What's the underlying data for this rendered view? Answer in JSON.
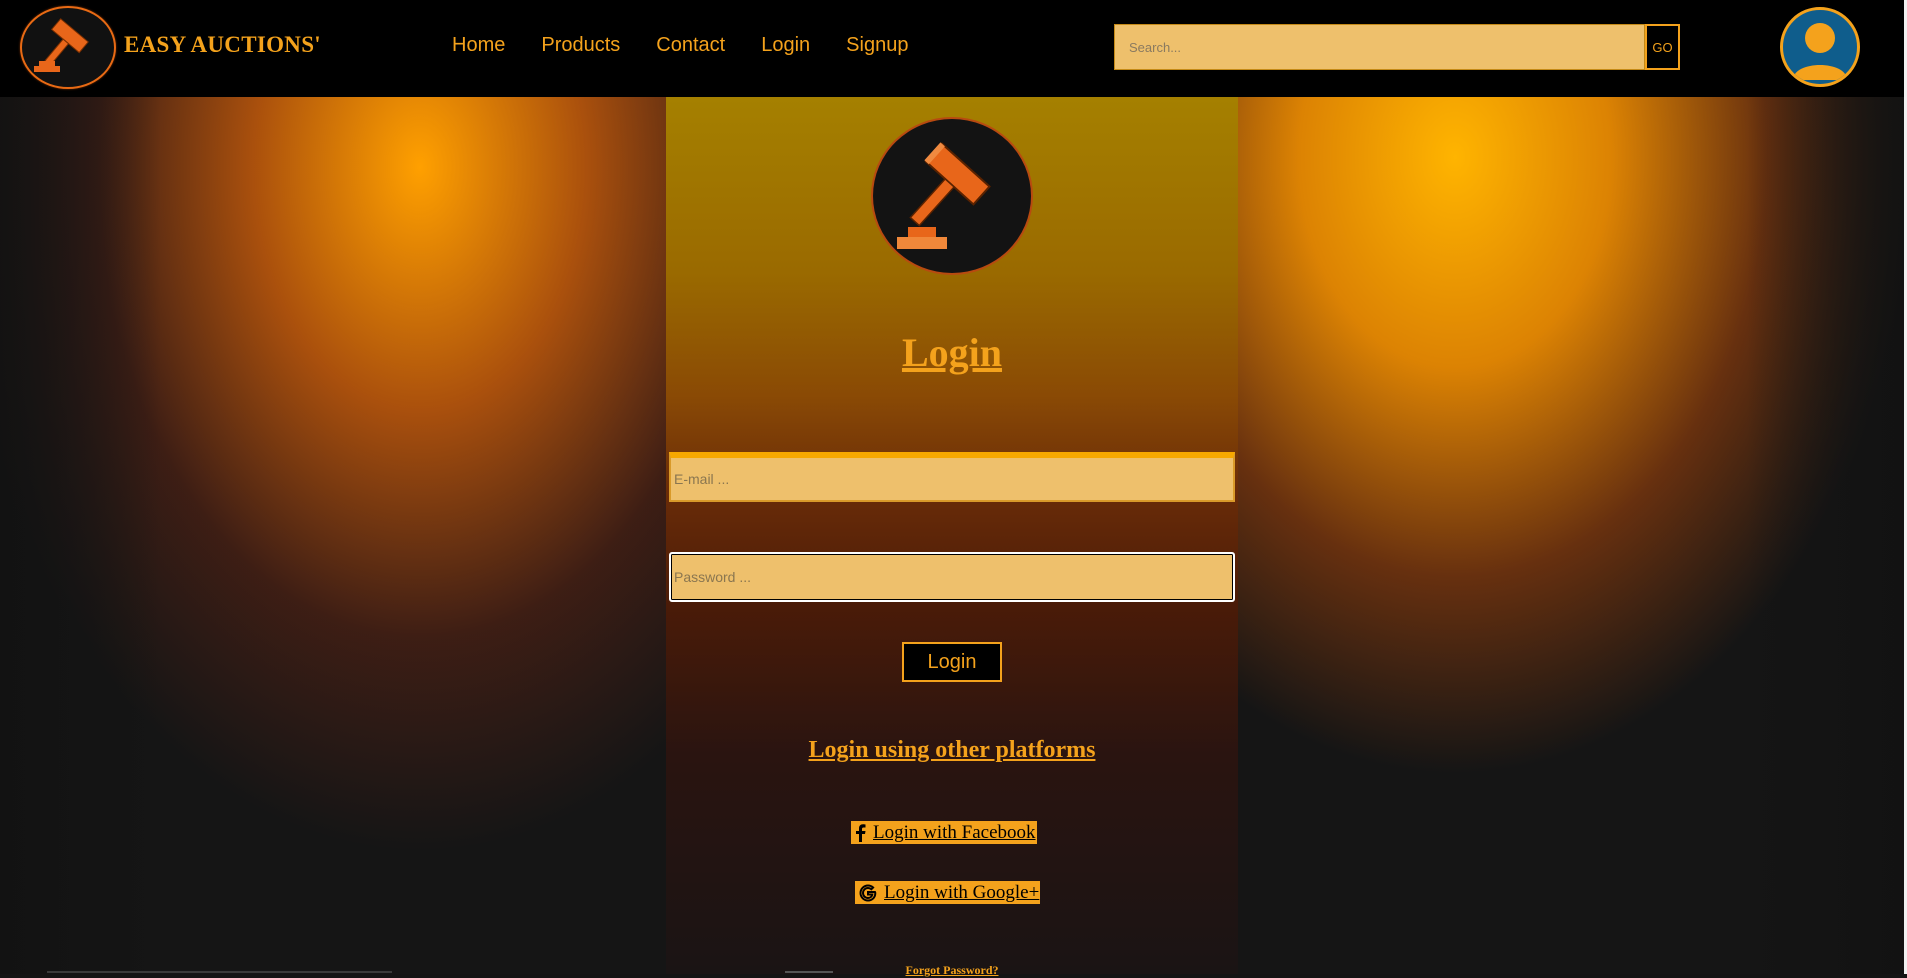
{
  "header": {
    "brand_name": "EASY AUCTIONS'",
    "brand_logo_icon": "gavel-icon",
    "nav_items": [
      {
        "label": "Home"
      },
      {
        "label": "Products"
      },
      {
        "label": "Contact"
      },
      {
        "label": "Login"
      },
      {
        "label": "Signup"
      }
    ],
    "search": {
      "placeholder": "Search...",
      "value": "",
      "button_label": "GO"
    },
    "avatar_icon": "user-icon"
  },
  "login_panel": {
    "logo_icon": "gavel-icon",
    "title": "Login",
    "email": {
      "placeholder": "E-mail ...",
      "value": ""
    },
    "password": {
      "placeholder": "Password ...",
      "value": ""
    },
    "login_button_label": "Login",
    "other_platforms_title": "Login using other platforms",
    "facebook_label": " Login with Facebook",
    "facebook_icon": "facebook-icon",
    "google_label": " Login with Google+",
    "google_icon": "google-icon",
    "forgot_password_label": "Forgot Password?"
  },
  "colors": {
    "accent": "#f4a21c",
    "input_bg": "#eec06c",
    "header_bg": "#000000",
    "avatar_bg": "#0f5d8c",
    "gavel": "#e8661a"
  }
}
